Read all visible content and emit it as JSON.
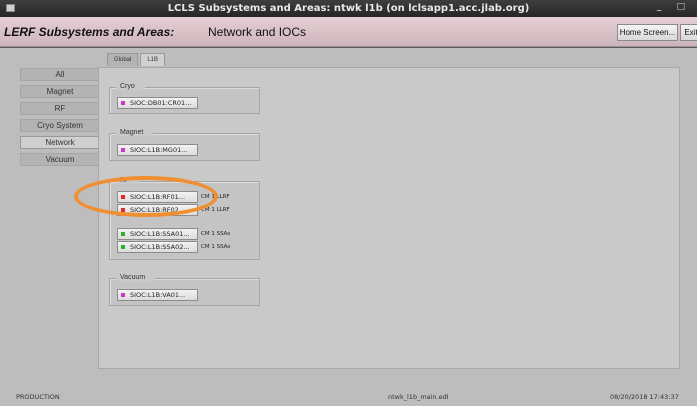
{
  "window": {
    "title": "LCLS Subsystems and Areas: ntwk l1b (on lclsapp1.acc.jlab.org)",
    "controls": "_ □"
  },
  "header": {
    "subtitle": "LERF Subsystems and Areas:",
    "page_title": "Network and IOCs",
    "home_button": "Home Screen...",
    "exit_button": "Exit"
  },
  "sidebar": {
    "items": [
      {
        "label": "All"
      },
      {
        "label": "Magnet"
      },
      {
        "label": "RF"
      },
      {
        "label": "Cryo System"
      },
      {
        "label": "Network"
      },
      {
        "label": "Vacuum"
      }
    ]
  },
  "tabs": [
    {
      "label": "Global"
    },
    {
      "label": "L1B"
    }
  ],
  "groups": {
    "cryo": {
      "label": "Cryo",
      "iocs": [
        {
          "label": "SIOC:DB01:CR01...",
          "status_color": "#c43cc4",
          "desc": ""
        }
      ]
    },
    "magnet": {
      "label": "Magnet",
      "iocs": [
        {
          "label": "SIOC:L1B:MG01...",
          "status_color": "#c43cc4",
          "desc": ""
        }
      ]
    },
    "rf": {
      "label": "RF",
      "iocs": [
        {
          "label": "SIOC:L1B:RF01...",
          "status_color": "#e02a2a",
          "desc": "CM 1 LLRF"
        },
        {
          "label": "SIOC:L1B:RF02...",
          "status_color": "#e02a2a",
          "desc": "CM 1 LLRF"
        },
        {
          "label": "SIOC:L1B:SSA01...",
          "status_color": "#2fae2f",
          "desc": "CM 1 SSAs"
        },
        {
          "label": "SIOC:L1B:SSA02...",
          "status_color": "#2fae2f",
          "desc": "CM 1 SSAs"
        }
      ]
    },
    "vacuum": {
      "label": "Vacuum",
      "iocs": [
        {
          "label": "SIOC:L1B:VA01...",
          "status_color": "#c43cc4",
          "desc": ""
        }
      ]
    }
  },
  "footer": {
    "mode": "PRODUCTION",
    "file": "ntwk_l1b_main.edl",
    "timestamp": "08/20/2018 17:43:37"
  },
  "annotation": {
    "color": "#f08f32"
  }
}
